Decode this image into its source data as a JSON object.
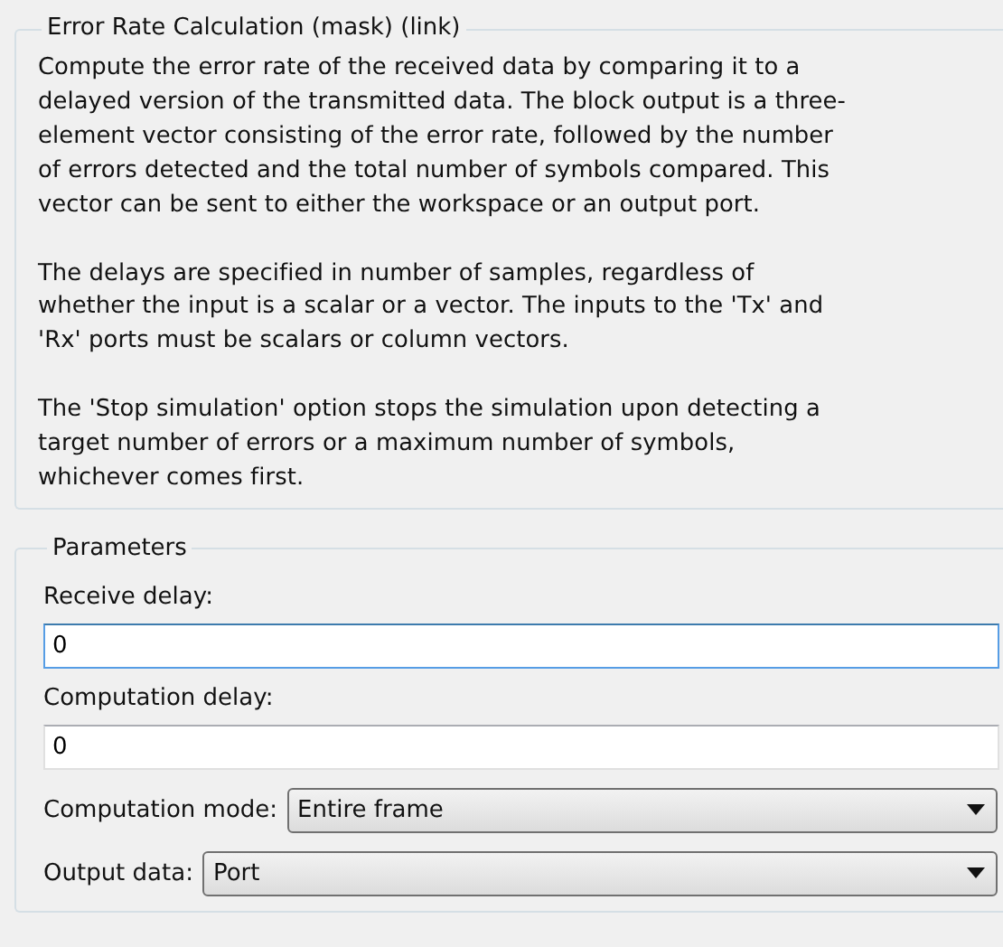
{
  "description": {
    "title": "Error Rate Calculation (mask) (link)",
    "paragraphs": [
      "Compute the error rate of the received data by comparing it to a\ndelayed version of the transmitted data. The block output is a three-\nelement vector consisting of the error rate, followed by the number\nof errors detected and the total number of symbols compared. This\nvector can be sent to either the workspace or an output port.",
      "The delays are specified in number of samples, regardless of\nwhether the input is a scalar or a vector. The inputs to the 'Tx' and\n'Rx' ports must be scalars or column vectors.",
      "The 'Stop simulation' option stops the simulation upon detecting a\ntarget number of errors or a maximum number of symbols,\nwhichever comes first."
    ]
  },
  "parameters": {
    "title": "Parameters",
    "fields": [
      {
        "kind": "text",
        "label": "Receive delay:",
        "value": "0",
        "focused": true
      },
      {
        "kind": "text",
        "label": "Computation delay:",
        "value": "0",
        "focused": false
      },
      {
        "kind": "dropdown",
        "label": "Computation mode:",
        "value": "Entire frame"
      },
      {
        "kind": "dropdown",
        "label": "Output data:",
        "value": "Port"
      }
    ]
  }
}
